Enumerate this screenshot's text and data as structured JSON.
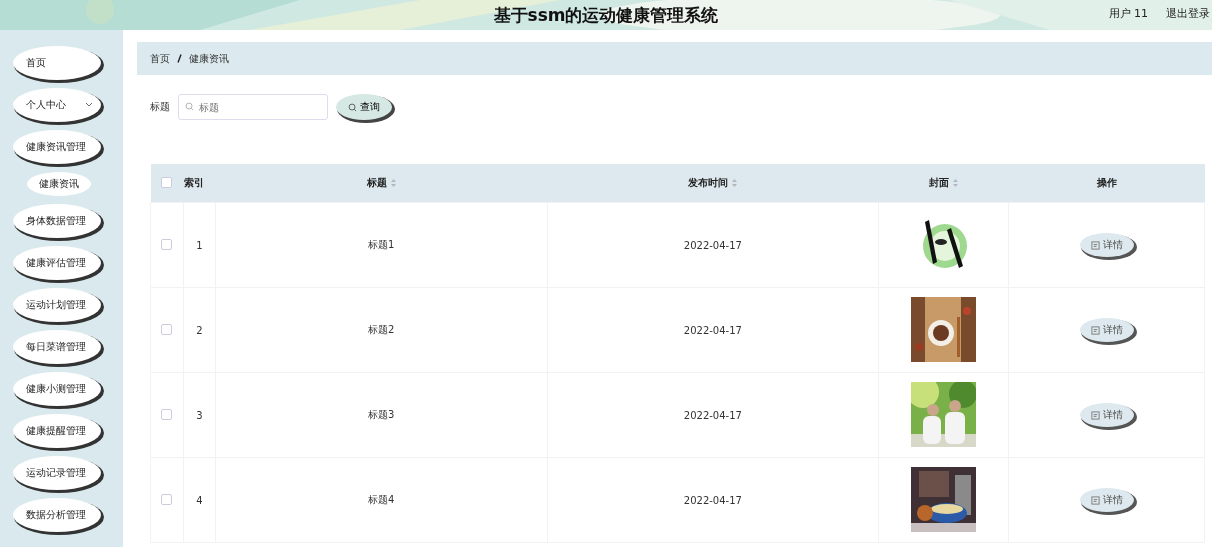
{
  "header": {
    "title": "基于ssm的运动健康管理系统",
    "user": "用户 11",
    "logout": "退出登录"
  },
  "sidebar": {
    "items": [
      {
        "label": "首页",
        "kind": "link"
      },
      {
        "label": "个人中心",
        "kind": "dropdown"
      },
      {
        "label": "健康资讯管理",
        "kind": "group",
        "children": [
          {
            "label": "健康资讯"
          }
        ]
      },
      {
        "label": "身体数据管理",
        "kind": "link"
      },
      {
        "label": "健康评估管理",
        "kind": "link"
      },
      {
        "label": "运动计划管理",
        "kind": "link"
      },
      {
        "label": "每日菜谱管理",
        "kind": "link"
      },
      {
        "label": "健康小测管理",
        "kind": "link"
      },
      {
        "label": "健康提醒管理",
        "kind": "link"
      },
      {
        "label": "运动记录管理",
        "kind": "link"
      },
      {
        "label": "数据分析管理",
        "kind": "link"
      }
    ]
  },
  "breadcrumb": [
    "首页",
    "健康资讯"
  ],
  "search": {
    "label": "标题",
    "placeholder": "标题",
    "button": "查询"
  },
  "table": {
    "all_checked": false,
    "columns": [
      {
        "label": "索引",
        "sortable": false
      },
      {
        "label": "标题",
        "sortable": true
      },
      {
        "label": "发布时间",
        "sortable": true
      },
      {
        "label": "封面",
        "sortable": true
      },
      {
        "label": "操作",
        "sortable": false
      }
    ],
    "rows": [
      {
        "index": "1",
        "title": "标题1",
        "date": "2022-04-17",
        "action": "详情",
        "checked": false
      },
      {
        "index": "2",
        "title": "标题2",
        "date": "2022-04-17",
        "action": "详情",
        "checked": false
      },
      {
        "index": "3",
        "title": "标题3",
        "date": "2022-04-17",
        "action": "详情",
        "checked": false
      },
      {
        "index": "4",
        "title": "标题4",
        "date": "2022-04-17",
        "action": "详情",
        "checked": false
      }
    ]
  }
}
